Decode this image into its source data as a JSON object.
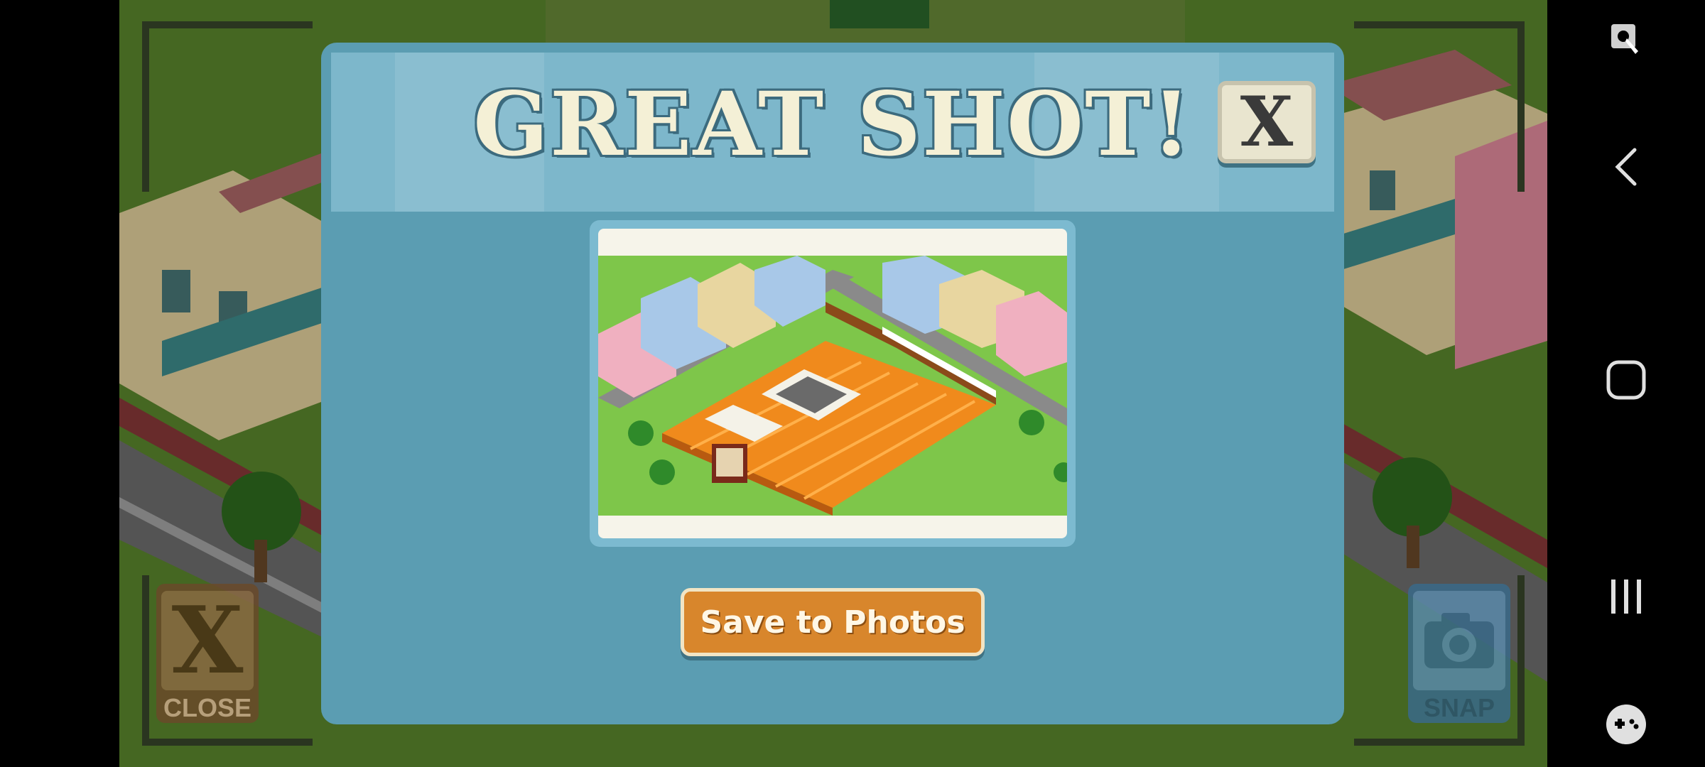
{
  "modal": {
    "title": "GREAT SHOT!",
    "close_label": "X",
    "save_button": "Save to Photos"
  },
  "game_controls": {
    "close_x": "X",
    "close_label": "CLOSE",
    "snap_label": "SNAP"
  },
  "navbar": {
    "icons": [
      "accessibility-icon",
      "back-icon",
      "home-icon",
      "recents-icon",
      "game-launcher-icon"
    ]
  },
  "colors": {
    "modal_bg": "#5b9db2",
    "header_bg": "#7db7cb",
    "save_button": "#d8862c",
    "grass": "#5d8a2e"
  }
}
